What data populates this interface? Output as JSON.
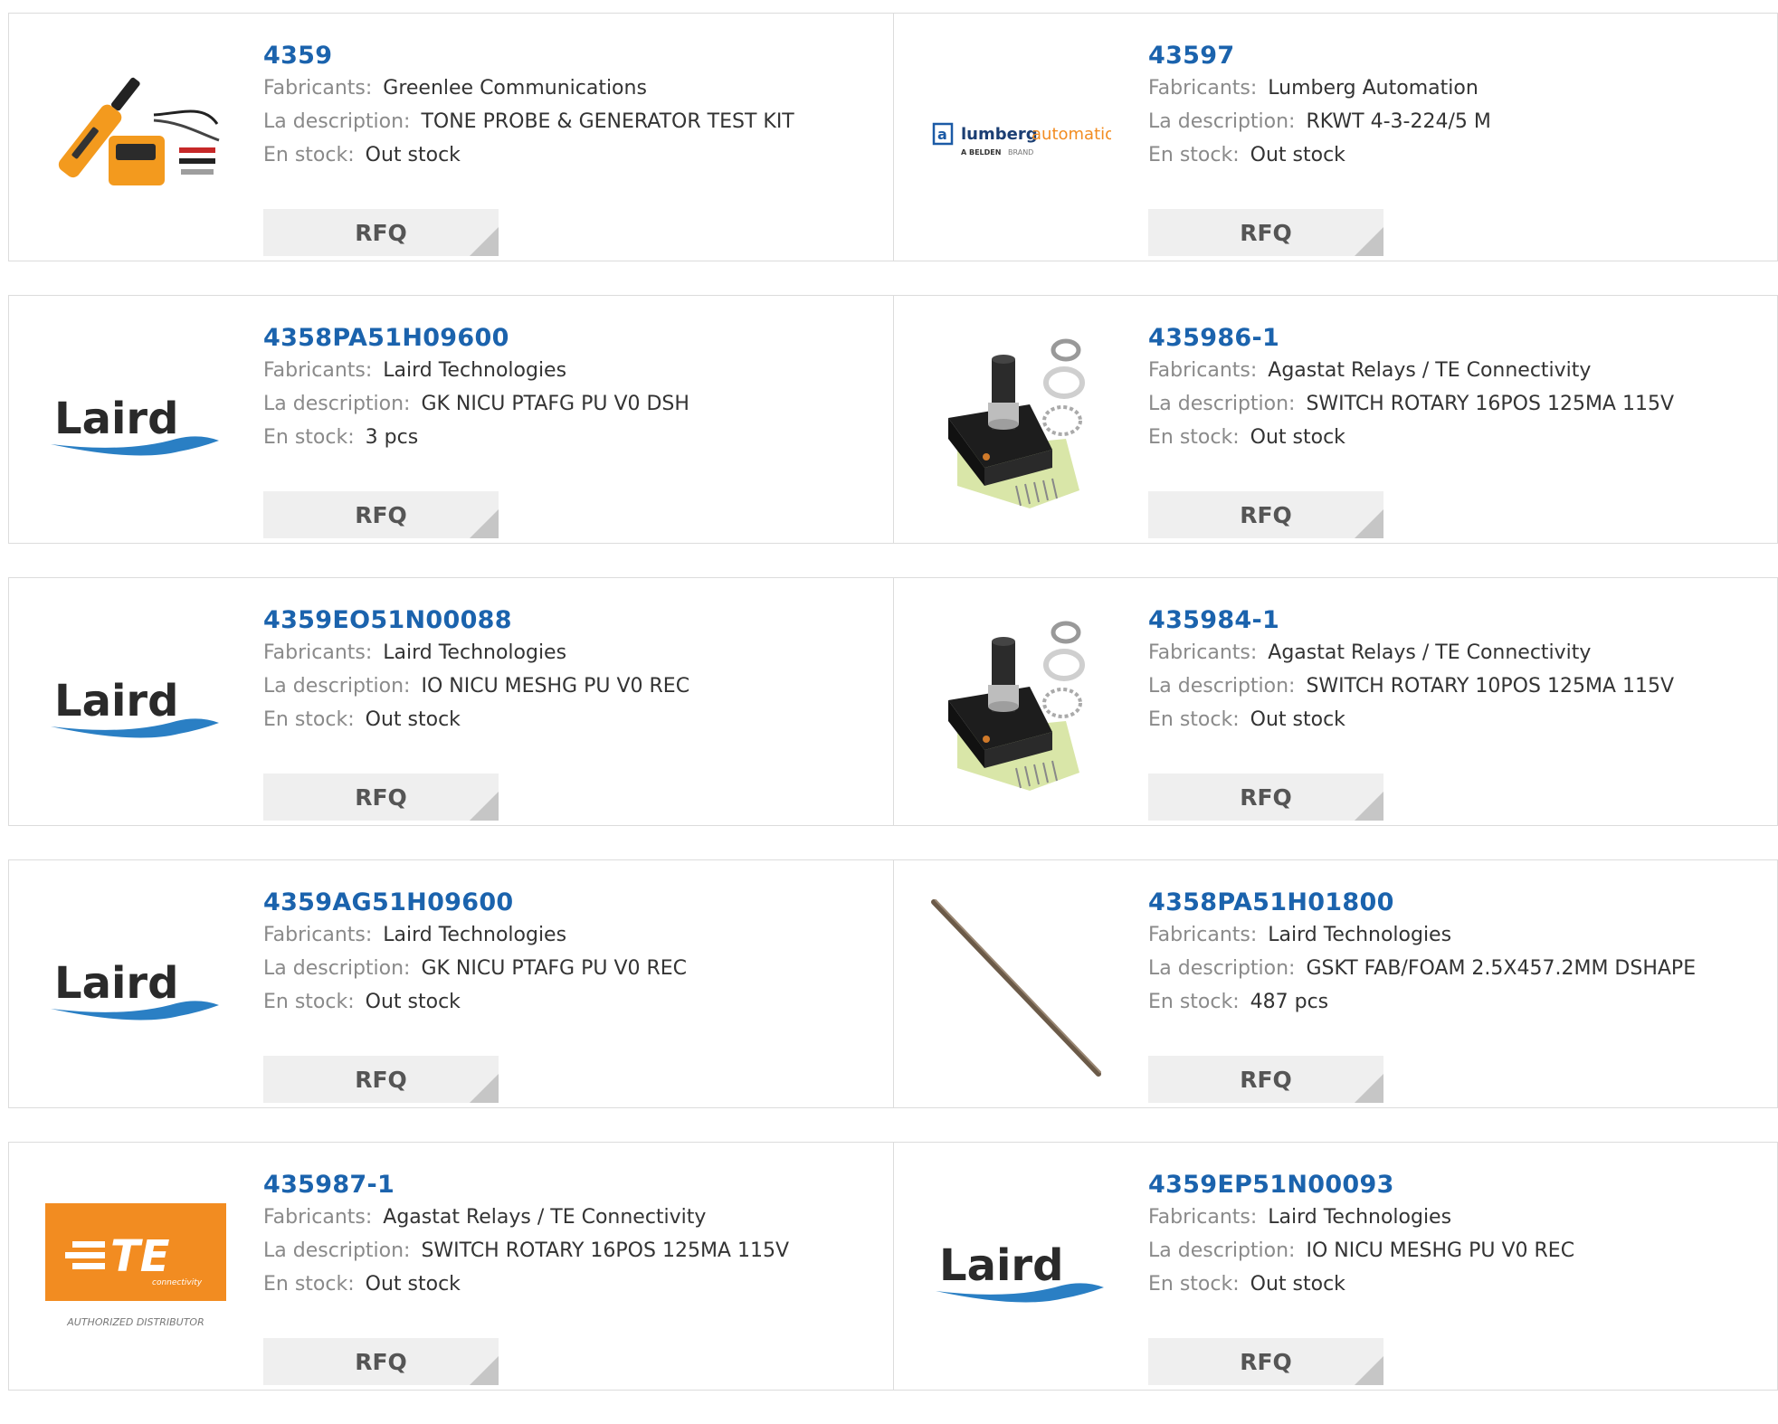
{
  "rows": [
    [
      {
        "part": "4359",
        "mfr_label": "Fabricants:",
        "mfr": "Greenlee Communications",
        "desc_label": "La description:",
        "desc": "TONE PROBE & GENERATOR TEST KIT",
        "stock_label": "En stock:",
        "stock": "Out stock",
        "rfq": "RFQ",
        "image": "tone-probe-kit-image"
      },
      {
        "part": "43597",
        "mfr_label": "Fabricants:",
        "mfr": "Lumberg Automation",
        "desc_label": "La description:",
        "desc": "RKWT 4-3-224/5 M",
        "stock_label": "En stock:",
        "stock": "Out stock",
        "rfq": "RFQ",
        "image": "lumberg-automation-logo",
        "logo_text": {
          "word1": "lumberg",
          "word2": "automation",
          "sub1": "A BELDEN",
          "sub2": "BRAND"
        }
      }
    ],
    [
      {
        "part": "4358PA51H09600",
        "mfr_label": "Fabricants:",
        "mfr": "Laird Technologies",
        "desc_label": "La description:",
        "desc": "GK NICU PTAFG PU V0 DSH",
        "stock_label": "En stock:",
        "stock": "3 pcs",
        "rfq": "RFQ",
        "image": "laird-logo",
        "logo_text": "Laird"
      },
      {
        "part": "435986-1",
        "mfr_label": "Fabricants:",
        "mfr": "Agastat Relays / TE Connectivity",
        "desc_label": "La description:",
        "desc": "SWITCH ROTARY 16POS 125MA 115V",
        "stock_label": "En stock:",
        "stock": "Out stock",
        "rfq": "RFQ",
        "image": "rotary-switch-image"
      }
    ],
    [
      {
        "part": "4359EO51N00088",
        "mfr_label": "Fabricants:",
        "mfr": "Laird Technologies",
        "desc_label": "La description:",
        "desc": "IO NICU MESHG PU V0 REC",
        "stock_label": "En stock:",
        "stock": "Out stock",
        "rfq": "RFQ",
        "image": "laird-logo",
        "logo_text": "Laird"
      },
      {
        "part": "435984-1",
        "mfr_label": "Fabricants:",
        "mfr": "Agastat Relays / TE Connectivity",
        "desc_label": "La description:",
        "desc": "SWITCH ROTARY 10POS 125MA 115V",
        "stock_label": "En stock:",
        "stock": "Out stock",
        "rfq": "RFQ",
        "image": "rotary-switch-image"
      }
    ],
    [
      {
        "part": "4359AG51H09600",
        "mfr_label": "Fabricants:",
        "mfr": "Laird Technologies",
        "desc_label": "La description:",
        "desc": "GK NICU PTAFG PU V0 REC",
        "stock_label": "En stock:",
        "stock": "Out stock",
        "rfq": "RFQ",
        "image": "laird-logo",
        "logo_text": "Laird"
      },
      {
        "part": "4358PA51H01800",
        "mfr_label": "Fabricants:",
        "mfr": "Laird Technologies",
        "desc_label": "La description:",
        "desc": "GSKT FAB/FOAM 2.5X457.2MM DSHAPE",
        "stock_label": "En stock:",
        "stock": "487 pcs",
        "rfq": "RFQ",
        "image": "gasket-strip-image"
      }
    ],
    [
      {
        "part": "435987-1",
        "mfr_label": "Fabricants:",
        "mfr": "Agastat Relays / TE Connectivity",
        "desc_label": "La description:",
        "desc": "SWITCH ROTARY 16POS 125MA 115V",
        "stock_label": "En stock:",
        "stock": "Out stock",
        "rfq": "RFQ",
        "image": "te-connectivity-logo",
        "logo_text": {
          "mark": "TE",
          "sub": "connectivity",
          "caption": "AUTHORIZED DISTRIBUTOR"
        }
      },
      {
        "part": "4359EP51N00093",
        "mfr_label": "Fabricants:",
        "mfr": "Laird Technologies",
        "desc_label": "La description:",
        "desc": "IO NICU MESHG PU V0 REC",
        "stock_label": "En stock:",
        "stock": "Out stock",
        "rfq": "RFQ",
        "image": "laird-logo",
        "logo_text": "Laird"
      }
    ]
  ],
  "colors": {
    "link": "#1b63ad",
    "label": "#8a8a8a",
    "button_bg": "#efefef",
    "te_orange": "#f28c21"
  }
}
